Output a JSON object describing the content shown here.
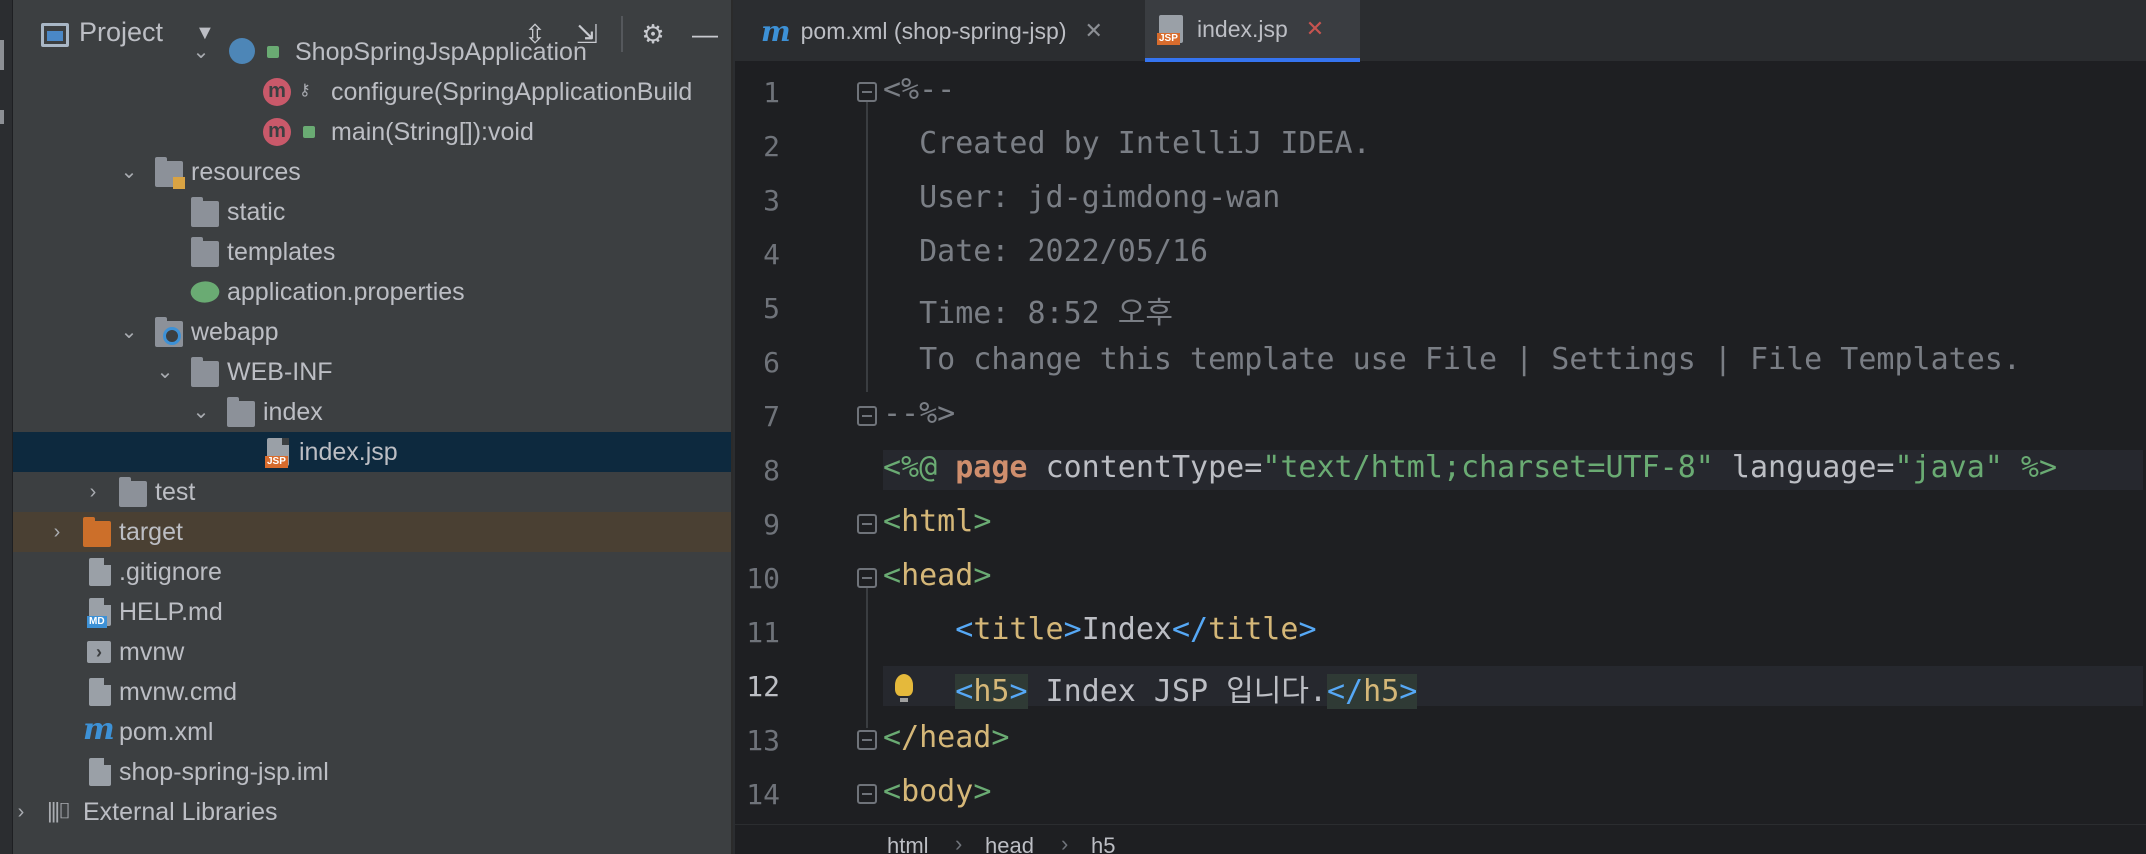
{
  "project_panel": {
    "title": "Project",
    "tree": [
      {
        "label": "ShopSpringJspApplication",
        "icon": "spring-boot-class-icon"
      },
      {
        "label": "configure(SpringApplicationBuild",
        "icon": "method-icon"
      },
      {
        "label": "main(String[]):void",
        "icon": "method-icon"
      },
      {
        "label": "resources",
        "icon": "resources-folder-icon"
      },
      {
        "label": "static",
        "icon": "folder-icon"
      },
      {
        "label": "templates",
        "icon": "folder-icon"
      },
      {
        "label": "application.properties",
        "icon": "spring-properties-icon"
      },
      {
        "label": "webapp",
        "icon": "web-folder-icon"
      },
      {
        "label": "WEB-INF",
        "icon": "folder-icon"
      },
      {
        "label": "index",
        "icon": "folder-icon"
      },
      {
        "label": "index.jsp",
        "icon": "jsp-file-icon"
      },
      {
        "label": "test",
        "icon": "folder-icon"
      },
      {
        "label": "target",
        "icon": "excluded-folder-icon"
      },
      {
        "label": ".gitignore",
        "icon": "ignored-file-icon"
      },
      {
        "label": "HELP.md",
        "icon": "markdown-file-icon"
      },
      {
        "label": "mvnw",
        "icon": "shell-file-icon"
      },
      {
        "label": "mvnw.cmd",
        "icon": "text-file-icon"
      },
      {
        "label": "pom.xml",
        "icon": "maven-icon"
      },
      {
        "label": "shop-spring-jsp.iml",
        "icon": "iml-file-icon"
      },
      {
        "label": "External Libraries",
        "icon": "libraries-icon"
      }
    ]
  },
  "tabs": [
    {
      "label": "pom.xml (shop-spring-jsp)",
      "close": "✕",
      "active": false
    },
    {
      "label": "index.jsp",
      "close": "✕",
      "active": true
    }
  ],
  "editor": {
    "current_line": 12,
    "line_numbers": [
      "1",
      "2",
      "3",
      "4",
      "5",
      "6",
      "7",
      "8",
      "9",
      "10",
      "11",
      "12",
      "13",
      "14"
    ],
    "lines": {
      "l1": "<%--",
      "l2": "  Created by IntelliJ IDEA.",
      "l3": "  User: jd-gimdong-wan",
      "l4": "  Date: 2022/05/16",
      "l5": "  Time: 8:52 오후",
      "l6": "  To change this template use File | Settings | File Templates.",
      "l7": "--%>",
      "l8_open": "<%@",
      "l8_kw": "page",
      "l8_attr1": "contentType=",
      "l8_val1": "\"text/html;charset=UTF-8\"",
      "l8_attr2": "language=",
      "l8_val2": "\"java\"",
      "l8_close": "%>",
      "l9": "html",
      "l10": "head",
      "l11_tag": "title",
      "l11_text": "Index",
      "l12_tag": "h5",
      "l12_text": " Index JSP 입니다.",
      "l13": "/head",
      "l14": "body"
    }
  },
  "breadcrumb": [
    "html",
    "head",
    "h5"
  ],
  "colors": {
    "accent": "#3574f0",
    "selection": "#0d293e",
    "string": "#6aab73",
    "keyword": "#cf8e6d",
    "tag": "#d5b778",
    "bracket": "#56a8f5"
  }
}
